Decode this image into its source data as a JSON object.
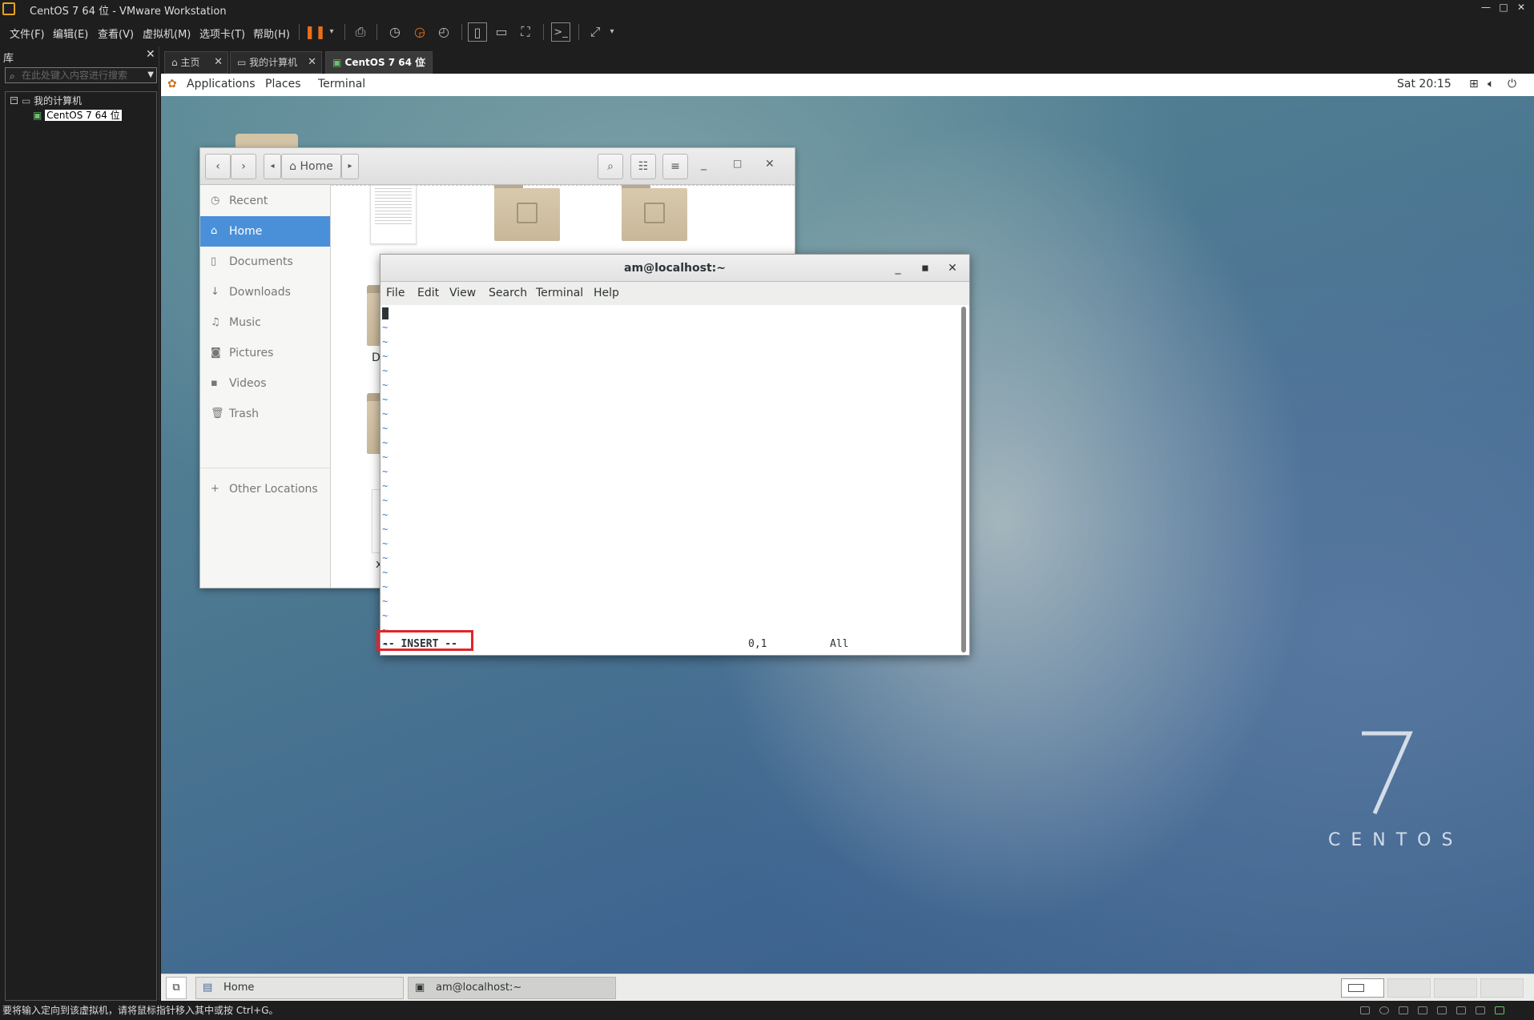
{
  "window": {
    "title": "CentOS 7 64 位 - VMware Workstation"
  },
  "menubar": {
    "items": [
      "文件(F)",
      "编辑(E)",
      "查看(V)",
      "虚拟机(M)",
      "选项卡(T)",
      "帮助(H)"
    ]
  },
  "library": {
    "title": "库",
    "search_placeholder": "在此处键入内容进行搜索",
    "tree": {
      "root": "我的计算机",
      "vm": "CentOS 7 64 位"
    }
  },
  "tabs": [
    {
      "label": "主页",
      "icon": "home-icon"
    },
    {
      "label": "我的计算机",
      "icon": "monitor-icon"
    },
    {
      "label": "CentOS 7 64 位",
      "icon": "vm-icon",
      "active": true
    }
  ],
  "gnome_topbar": {
    "applications": "Applications",
    "places": "Places",
    "terminal": "Terminal",
    "clock": "Sat 20:15"
  },
  "file_manager": {
    "location": "Home",
    "sidebar": [
      {
        "label": "Recent",
        "icon": "clock-icon"
      },
      {
        "label": "Home",
        "icon": "home-icon",
        "selected": true
      },
      {
        "label": "Documents",
        "icon": "document-icon"
      },
      {
        "label": "Downloads",
        "icon": "download-icon"
      },
      {
        "label": "Music",
        "icon": "music-icon"
      },
      {
        "label": "Pictures",
        "icon": "camera-icon"
      },
      {
        "label": "Videos",
        "icon": "film-icon"
      },
      {
        "label": "Trash",
        "icon": "trash-icon"
      }
    ],
    "other_locations": "Other Locations",
    "partial_labels": [
      "D",
      "x"
    ]
  },
  "terminal": {
    "title": "am@localhost:~",
    "menu": [
      "File",
      "Edit",
      "View",
      "Search",
      "Terminal",
      "Help"
    ],
    "tilde": "~",
    "status_mode": "-- INSERT --",
    "status_position": "0,1",
    "status_scroll": "All",
    "highlight_color": "#e0252a"
  },
  "desktop": {
    "logo_text": "CENTOS"
  },
  "taskbar": {
    "items": [
      {
        "label": "Home",
        "icon": "file-manager-icon"
      },
      {
        "label": "am@localhost:~",
        "icon": "terminal-icon"
      }
    ]
  },
  "statusbar": {
    "message": "要将输入定向到该虚拟机，请将鼠标指针移入其中或按 Ctrl+G。"
  },
  "colors": {
    "accent": "#4a90d9",
    "vm_bg": "#1e1e1e",
    "pause": "#e8701a"
  }
}
